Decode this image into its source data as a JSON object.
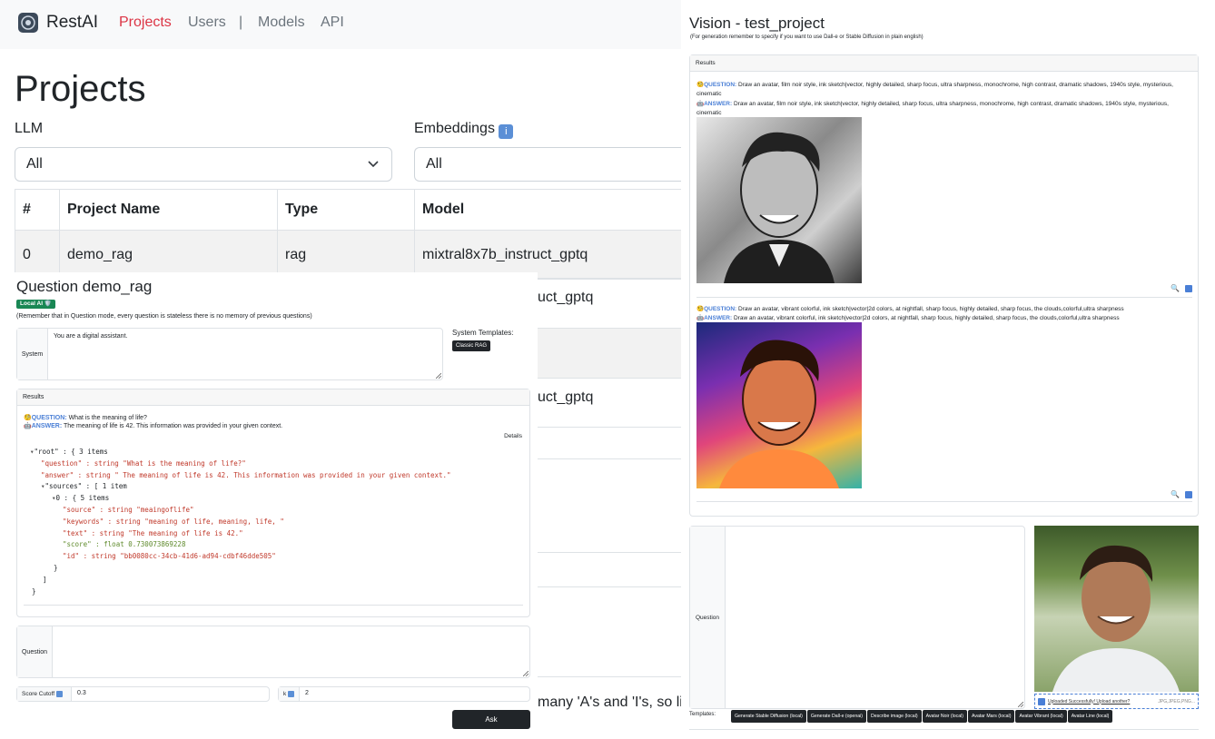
{
  "nav": {
    "brand": "RestAI",
    "links": [
      "Projects",
      "Users",
      "|",
      "Models",
      "API"
    ]
  },
  "projects_page": {
    "title": "Projects",
    "llm_label": "LLM",
    "llm_value": "All",
    "embeddings_label": "Embeddings",
    "embeddings_info": "ℹ️",
    "embeddings_value": "All",
    "table": {
      "headers": [
        "#",
        "Project Name",
        "Type",
        "Model"
      ],
      "rows": [
        [
          "0",
          "demo_rag",
          "rag",
          "mixtral8x7b_instruct_gptq"
        ]
      ],
      "partial_model_cells": [
        "uct_gptq",
        "uct_gptq"
      ],
      "partial_text": "many 'A's and 'I's, so li"
    }
  },
  "question_panel": {
    "title": "Question demo_rag",
    "badge": "Local AI 🛡️",
    "note": "(Remember that in Question mode, every question is stateless there is no memory of previous questions)",
    "system_label": "System",
    "system_value": "You are a digital assistant.",
    "system_templates_label": "System Templates:",
    "template_button": "Classic RAG",
    "results_label": "Results",
    "question_prefix": "QUESTION:",
    "question_text": "What is the meaning of life?",
    "answer_prefix": "ANSWER:",
    "answer_text": "The meaning of life is 42. This information was provided in your given context.",
    "details_label": "Details",
    "json_lines": [
      "\"root\" : { 3 items",
      "\"question\" : string \"What is the meaning of life?\"",
      "\"answer\" : string \" The meaning of life is 42. This information was provided in your given context.\"",
      "\"sources\" : [ 1 item",
      "0 : { 5 items",
      "\"source\" : string \"meaingoflife\"",
      "\"keywords\" : string \"meaning of life, meaning, life, \"",
      "\"text\" : string \"The meaning of life is 42.\"",
      "\"score\" : float 0.730073869228",
      "\"id\" : string \"bb0080cc-34cb-41d6-ad94-cdbf46dde505\"",
      "}",
      "]",
      "}"
    ],
    "question_label": "Question",
    "question_value": "",
    "score_cutoff_label": "Score Cutoff",
    "score_cutoff_value": "0.3",
    "k_label": "k",
    "k_value": "2",
    "ask_button": "Ask"
  },
  "vision_panel": {
    "title": "Vision - test_project",
    "note": "(For generation remember to specify if you want to use Dall-e or Stable Diffusion in plain english)",
    "results_label": "Results",
    "results": [
      {
        "question_prefix": "QUESTION:",
        "question": "Draw an avatar, film noir style, ink sketch|vector, highly detailed, sharp focus, ultra sharpness, monochrome, high contrast, dramatic shadows, 1940s style, mysterious, cinematic",
        "answer_prefix": "ANSWER:",
        "answer": "Draw an avatar, film noir style, ink sketch|vector, highly detailed, sharp focus, ultra sharpness, monochrome, high contrast, dramatic shadows, 1940s style, mysterious, cinematic"
      },
      {
        "question_prefix": "QUESTION:",
        "question": "Draw an avatar, vibrant colorful, ink sketch|vector|2d colors, at nightfall, sharp focus, highly detailed, sharp focus, the clouds,colorful,ultra sharpness",
        "answer_prefix": "ANSWER:",
        "answer": "Draw an avatar, vibrant colorful, ink sketch|vector|2d colors, at nightfall, sharp focus, highly detailed, sharp focus, the clouds,colorful,ultra sharpness"
      }
    ],
    "question_label": "Question",
    "upload_text": "Uploaded Successfully! Upload another?",
    "upload_types": "JPG,JPEG,PNG...",
    "templates_label": "Templates:",
    "template_buttons": [
      "Generate Stable Diffusion (local)",
      "Generate Dall-e (openai)",
      "Describe image (local)",
      "Avatar Noir (local)",
      "Avatar Mars (local)",
      "Avatar Vibrant (local)",
      "Avatar Line (local)"
    ]
  }
}
